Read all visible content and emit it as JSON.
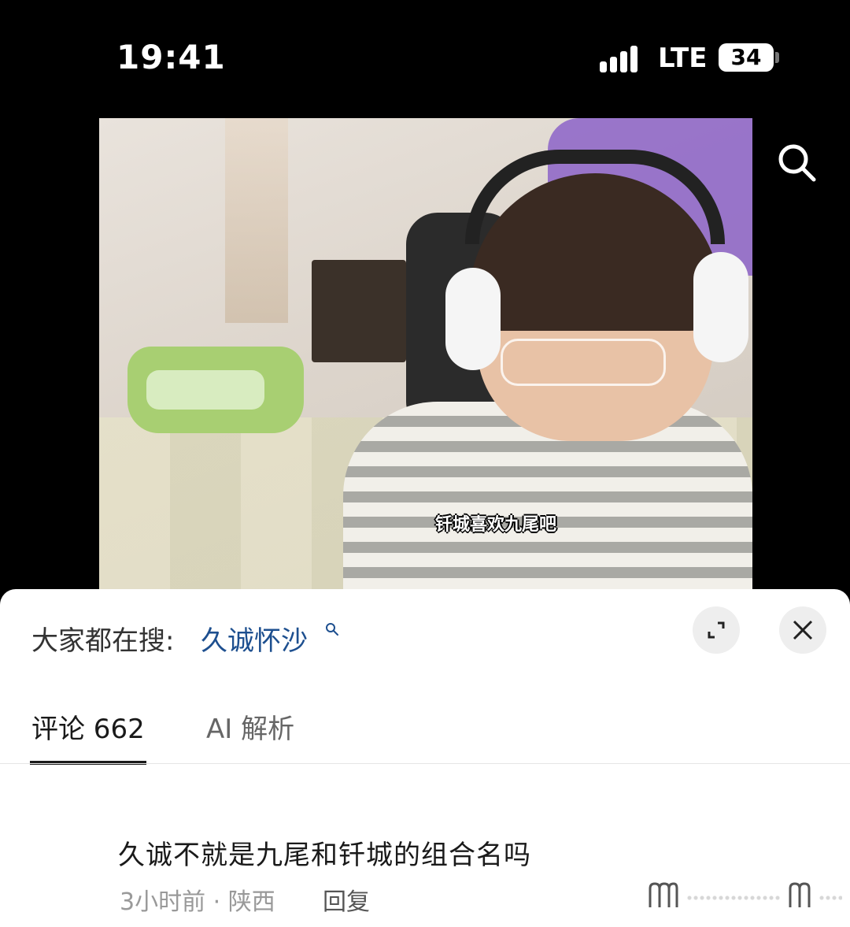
{
  "status_bar": {
    "time": "19:41",
    "network": "LTE",
    "battery": "34"
  },
  "video": {
    "subtitle": "钎城喜欢九尾吧"
  },
  "trending": {
    "label": "大家都在搜:",
    "query": "久诚怀沙"
  },
  "tabs": [
    {
      "label": "评论 662"
    },
    {
      "label": "AI 解析"
    }
  ],
  "comment": {
    "text": "久诚不就是九尾和钎城的组合名吗",
    "meta": "3小时前 · 陕西",
    "reply_label": "回复"
  }
}
